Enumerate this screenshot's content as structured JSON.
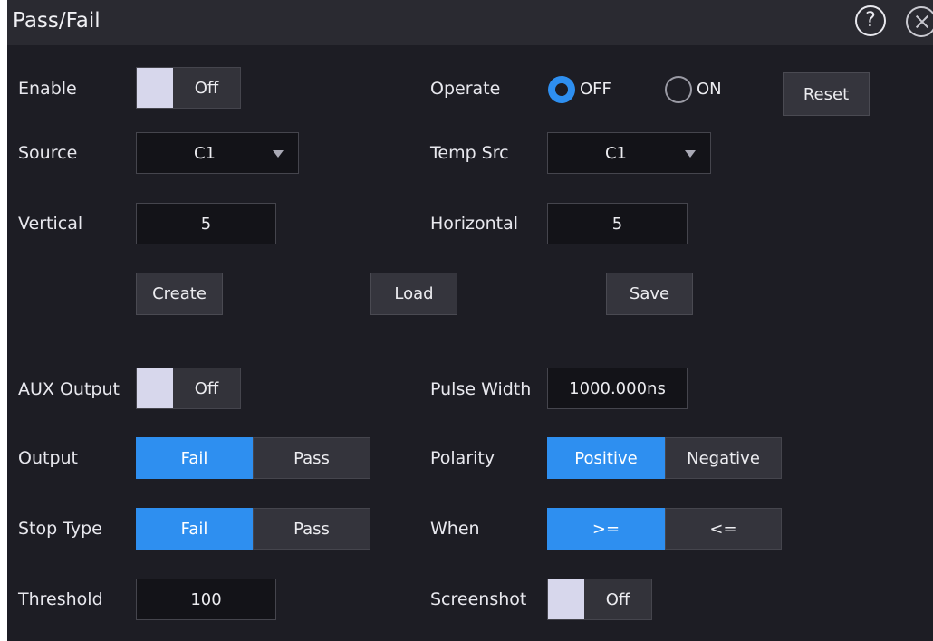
{
  "window": {
    "title": "Pass/Fail",
    "help_label": "?"
  },
  "enable": {
    "label": "Enable",
    "value": "Off"
  },
  "operate": {
    "label": "Operate",
    "options": [
      "OFF",
      "ON"
    ],
    "selected": "OFF",
    "reset_label": "Reset"
  },
  "source": {
    "label": "Source",
    "value": "C1"
  },
  "temp_src": {
    "label": "Temp Src",
    "value": "C1"
  },
  "vertical": {
    "label": "Vertical",
    "value": "5"
  },
  "horizontal": {
    "label": "Horizontal",
    "value": "5"
  },
  "actions": {
    "create": "Create",
    "load": "Load",
    "save": "Save"
  },
  "aux_output": {
    "label": "AUX Output",
    "value": "Off"
  },
  "pulse_width": {
    "label": "Pulse Width",
    "value": "1000.000ns"
  },
  "output": {
    "label": "Output",
    "options": [
      "Fail",
      "Pass"
    ],
    "selected": "Fail"
  },
  "polarity": {
    "label": "Polarity",
    "options": [
      "Positive",
      "Negative"
    ],
    "selected": "Positive"
  },
  "stop_type": {
    "label": "Stop Type",
    "options": [
      "Fail",
      "Pass"
    ],
    "selected": "Fail"
  },
  "when": {
    "label": "When",
    "options": [
      ">=",
      "<="
    ],
    "selected": ">="
  },
  "threshold": {
    "label": "Threshold",
    "value": "100"
  },
  "screenshot": {
    "label": "Screenshot",
    "value": "Off"
  },
  "colors": {
    "accent": "#2e8ff0",
    "background": "#1d1d24",
    "titlebar": "#2a2a31",
    "toggle_knob": "#d7d7ec"
  },
  "icons": {
    "help": "question-circle-icon",
    "close": "close-circle-icon",
    "dropdown": "triangle-down-icon"
  }
}
